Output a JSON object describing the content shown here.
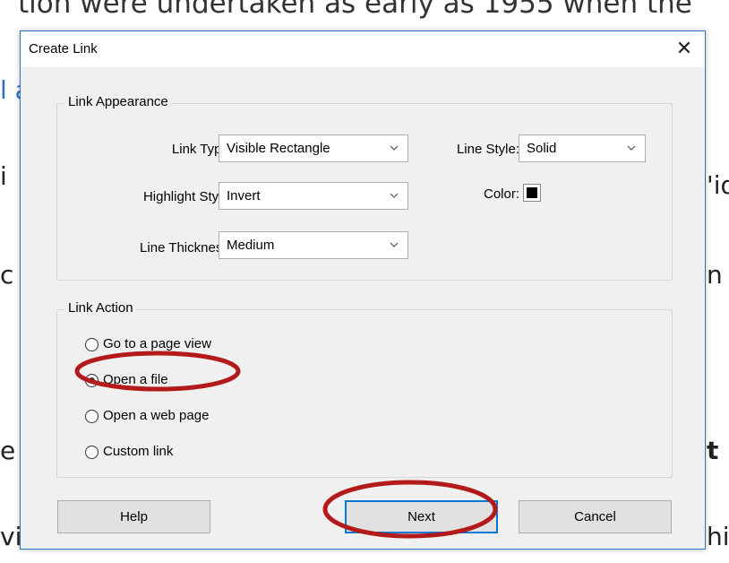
{
  "background": {
    "top_line": "tion were undertaken as early as 1955 when the",
    "left_fragments": [
      "l a",
      "i",
      "c",
      "e",
      "vi"
    ],
    "right_fragments": [
      "'id",
      "n f",
      "t :",
      "hic"
    ]
  },
  "dialog": {
    "title": "Create Link",
    "close_glyph": "✕",
    "appearance": {
      "legend": "Link Appearance",
      "link_type_label": "Link Type:",
      "link_type_value": "Visible Rectangle",
      "line_style_label": "Line Style:",
      "line_style_value": "Solid",
      "highlight_label": "Highlight Style:",
      "highlight_value": "Invert",
      "color_label": "Color:",
      "color_value": "#000000",
      "thickness_label": "Line Thickness:",
      "thickness_value": "Medium"
    },
    "action": {
      "legend": "Link Action",
      "options": [
        {
          "label": "Go to a page view",
          "selected": false
        },
        {
          "label": "Open a file",
          "selected": true
        },
        {
          "label": "Open a web page",
          "selected": false
        },
        {
          "label": "Custom link",
          "selected": false
        }
      ]
    },
    "buttons": {
      "help": "Help",
      "next": "Next",
      "cancel": "Cancel"
    }
  },
  "colors": {
    "annotation": "#b31b1b",
    "focus_border": "#0078d7",
    "title_border": "#2c6fc6"
  }
}
